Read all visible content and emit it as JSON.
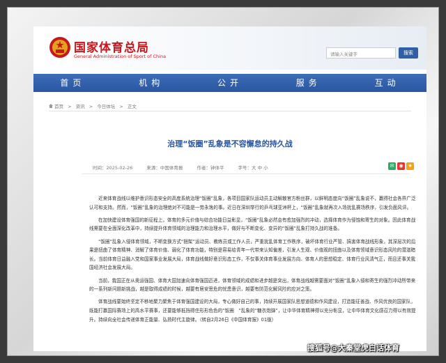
{
  "header": {
    "site_name": "国家体育总局",
    "site_name_en": "General Administration of Sport of China",
    "search_placeholder": "请输入关键字",
    "search_button": "搜索"
  },
  "nav": {
    "items": [
      "首页",
      "机构",
      "公开",
      "服务",
      "互动"
    ]
  },
  "breadcrumb": {
    "items": [
      "首页",
      ">",
      "资讯",
      ">",
      "今日体坛",
      ">",
      "正文"
    ]
  },
  "article": {
    "title": "治理“饭圈”乱象是不容懈怠的持久战",
    "time": "时间：2025-02-26",
    "source": "来源：中国体育报",
    "author": "作者：钟体平",
    "font_size": "字号：大 中 小",
    "paragraphs": [
      "近来体育战线以维护意识形态安全的高度系统治理“饭圈”乱象，各项目国家队运动员主动解散官方粉丝群，以鲜明态度向“饭圈”乱象说不，赢得社会各界广泛认可和支持。然而，“饭圈”乱象的治理绝对不可能是一劳永逸的事。近日在深圳举行的乒乓球亚洲杯上，“饭圈”乱象就再次入场扰乱赛场秩序，引发负面风评。",
      "在加快建设体育强国的新征程上，体育的多元价值与综合功能日益彰显，“饭圈”乱象必然会有愈加强烈的冲动，选择体育作为侵蚀和寄生的对象。因此体育战线需要在全面深化改革中，持续提升体育领域的治理能力和治理水平，做好与不断变化、变异的“饭圈”乱象打持久战的准备。",
      "“饭圈”乱象入侵体育领域，不断变换方式“捆架”运动员、教练员或工作人员，严重扰乱体育工作秩序，破坏体育行业严管、搞害体育战线形象，其深层次的后果是扭曲了体育精神、消解了体育价值、弱化了体育功能，特别是容易给青年一代带来认知偏差，引发人生观、价值观的扭曲以及体育领域意识形态风险的潜滋暗长。当前体育日益融入党和国家事业发展大局，体育战线做好意识形态工作，不仅事关体育事业发展方向、体育人的思想稳定、体育行业风清气正，而且还事关我国经济社会发展大局。",
      "当前，我国正在从奥运强国、体育大国加速向体育强国迈进，体育领域的成绩和进步越是突出，体育战线越需要面对“饭圈”乱象入侵和寄生的强烈冲动所带来的一系列新问题新挑战，越是取得成绩的时候，越要有居安思危的忧患意识，越要有防范化解风险的应对之策。",
      "体育战线要始终坚定不移地聚力聚焦于体育强国建设的大局，专心做好自己的事，持续开展国家队思想道德和作风建设，打造能征善战、作风优良的国家队，既能打赢国际赛场上的高水平赛事，还要能够抵挡得住形形色色的“饭圈　”乱象的“糖衣炮弹”，让中华体育精神得以充分彰显，让中华体育文化感召力得以有效提升。持续向全社会传递体育正能量、弘扬时代主旋律。（转自2月26日《中国体育报》01版）"
    ]
  },
  "watermark": "搜狐号@大秦堂虎白话体育",
  "colors": {
    "brand_red": "#c8161d",
    "nav_blue": "#2f5fa6",
    "title_blue": "#2a56a0"
  }
}
